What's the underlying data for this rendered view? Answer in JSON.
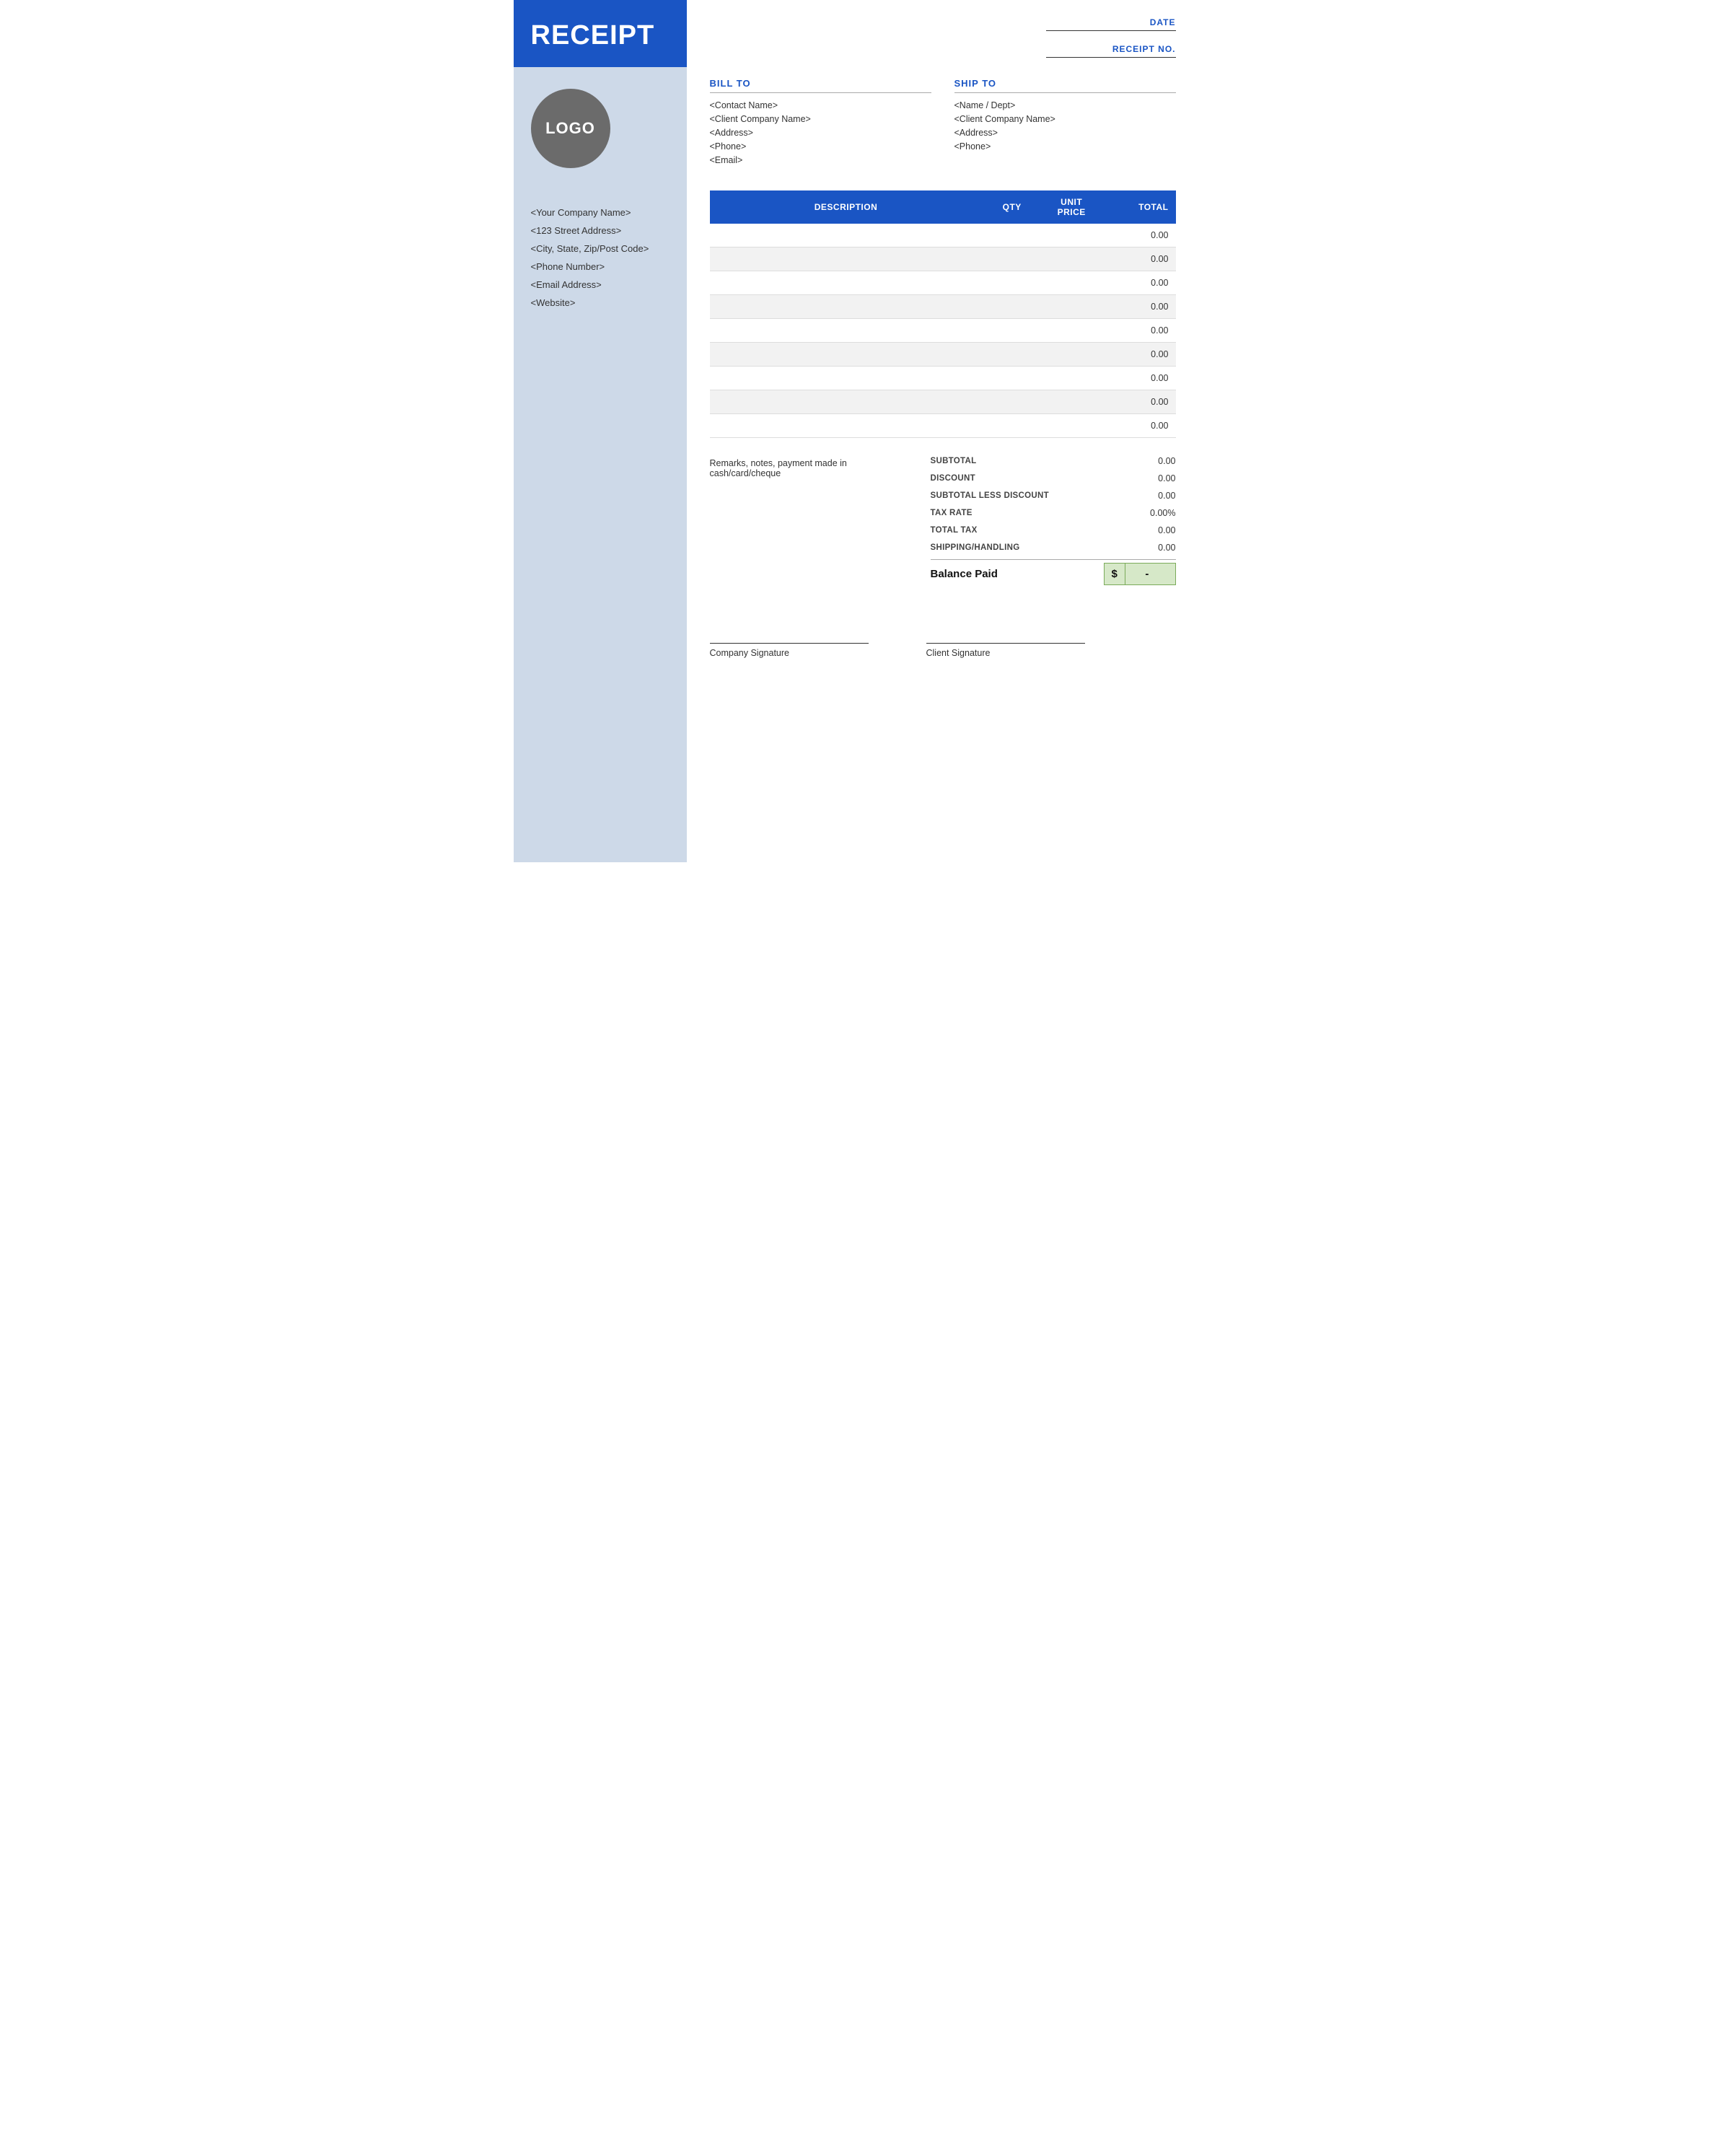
{
  "sidebar": {
    "title": "RECEIPT",
    "logo_text": "LOGO",
    "company_name": "<Your Company Name>",
    "address": "<123 Street Address>",
    "city_state": "<City, State, Zip/Post Code>",
    "phone": "<Phone Number>",
    "email": "<Email Address>",
    "website": "<Website>"
  },
  "meta": {
    "date_label": "DATE",
    "receipt_no_label": "RECEIPT NO."
  },
  "bill_to": {
    "title": "BILL TO",
    "contact": "<Contact Name>",
    "company": "<Client Company Name>",
    "address": "<Address>",
    "phone": "<Phone>",
    "email": "<Email>"
  },
  "ship_to": {
    "title": "SHIP TO",
    "name_dept": "<Name / Dept>",
    "company": "<Client Company Name>",
    "address": "<Address>",
    "phone": "<Phone>"
  },
  "table": {
    "headers": {
      "description": "DESCRIPTION",
      "qty": "QTY",
      "unit_price": "UNIT PRICE",
      "total": "TOTAL"
    },
    "rows": [
      {
        "description": "",
        "qty": "",
        "unit_price": "",
        "total": "0.00"
      },
      {
        "description": "",
        "qty": "",
        "unit_price": "",
        "total": "0.00"
      },
      {
        "description": "",
        "qty": "",
        "unit_price": "",
        "total": "0.00"
      },
      {
        "description": "",
        "qty": "",
        "unit_price": "",
        "total": "0.00"
      },
      {
        "description": "",
        "qty": "",
        "unit_price": "",
        "total": "0.00"
      },
      {
        "description": "",
        "qty": "",
        "unit_price": "",
        "total": "0.00"
      },
      {
        "description": "",
        "qty": "",
        "unit_price": "",
        "total": "0.00"
      },
      {
        "description": "",
        "qty": "",
        "unit_price": "",
        "total": "0.00"
      },
      {
        "description": "",
        "qty": "",
        "unit_price": "",
        "total": "0.00"
      }
    ]
  },
  "remarks": "Remarks, notes, payment made in cash/card/cheque",
  "totals": {
    "subtotal_label": "SUBTOTAL",
    "subtotal_value": "0.00",
    "discount_label": "DISCOUNT",
    "discount_value": "0.00",
    "subtotal_less_discount_label": "SUBTOTAL LESS DISCOUNT",
    "subtotal_less_discount_value": "0.00",
    "tax_rate_label": "TAX RATE",
    "tax_rate_value": "0.00%",
    "total_tax_label": "TOTAL TAX",
    "total_tax_value": "0.00",
    "shipping_label": "SHIPPING/HANDLING",
    "shipping_value": "0.00",
    "balance_label": "Balance Paid",
    "balance_dollar": "$",
    "balance_value": "-"
  },
  "signatures": {
    "company": "Company Signature",
    "client": "Client Signature"
  }
}
